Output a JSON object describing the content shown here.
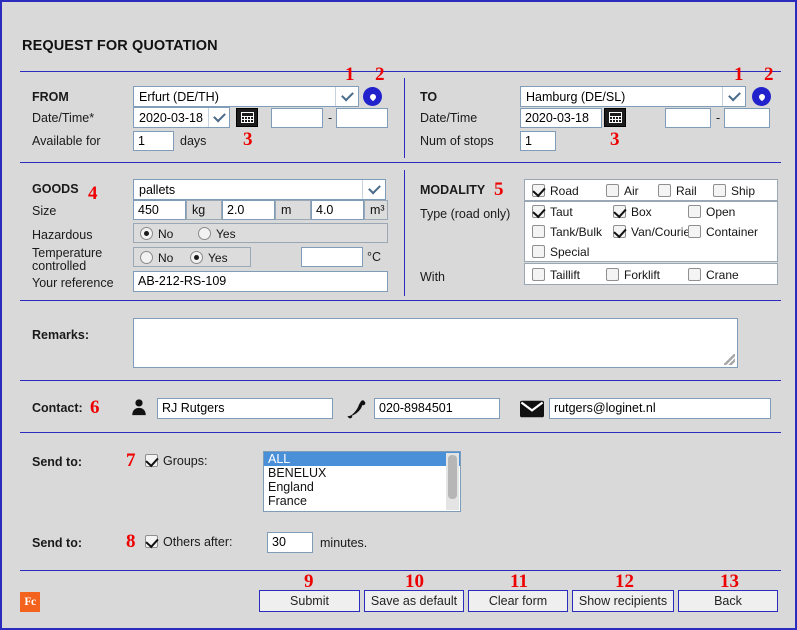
{
  "page": {
    "title": "REQUEST FOR QUOTATION",
    "logo_text": "Fc",
    "accent_color": "#2b2bbd",
    "marker_color": "#ee0000",
    "background": "#d9d9d9"
  },
  "from": {
    "label": "FROM",
    "location": "Erfurt (DE/TH)",
    "datetime_label": "Date/Time*",
    "date_value": "2020-03-18",
    "time_from": "",
    "time_sep": "-",
    "time_to": "",
    "available_label": "Available for",
    "available_value": "1",
    "available_unit": "days",
    "marker_dropdown": "1",
    "marker_pin": "2",
    "marker_calendar": "3"
  },
  "to": {
    "label": "TO",
    "location": "Hamburg (DE/SL)",
    "datetime_label": "Date/Time",
    "date_value": "2020-03-18",
    "time_from": "",
    "time_sep": "-",
    "time_to": "",
    "stops_label": "Num of stops",
    "stops_value": "1",
    "marker_dropdown": "1",
    "marker_pin": "2",
    "marker_calendar": "3"
  },
  "goods": {
    "label": "GOODS",
    "marker": "4",
    "type_value": "pallets",
    "size_label": "Size",
    "weight_value": "450",
    "weight_unit": "kg",
    "length_value": "2.0",
    "length_unit": "m",
    "volume_value": "4.0",
    "volume_unit": "m³",
    "hazardous_label": "Hazardous",
    "hazardous_no": "No",
    "hazardous_yes": "Yes",
    "hazardous_selected": "No",
    "temp_label_1": "Temperature",
    "temp_label_2": "controlled",
    "temp_no": "No",
    "temp_yes": "Yes",
    "temp_selected": "Yes",
    "temp_value": "",
    "temp_unit": "°C",
    "reference_label": "Your reference",
    "reference_value": "AB-212-RS-109"
  },
  "modality": {
    "label": "MODALITY",
    "marker": "5",
    "type_label": "Type (road only)",
    "with_label": "With",
    "transport": [
      {
        "label": "Road",
        "checked": true
      },
      {
        "label": "Air",
        "checked": false
      },
      {
        "label": "Rail",
        "checked": false
      },
      {
        "label": "Ship",
        "checked": false
      }
    ],
    "types": [
      {
        "label": "Taut",
        "checked": true
      },
      {
        "label": "Box",
        "checked": true
      },
      {
        "label": "Open",
        "checked": false
      },
      {
        "label": "Tank/Bulk",
        "checked": false
      },
      {
        "label": "Van/Courier",
        "checked": true
      },
      {
        "label": "Container",
        "checked": false
      },
      {
        "label": "Special",
        "checked": false
      }
    ],
    "equipment": [
      {
        "label": "Taillift",
        "checked": false
      },
      {
        "label": "Forklift",
        "checked": false
      },
      {
        "label": "Crane",
        "checked": false
      }
    ]
  },
  "remarks": {
    "label": "Remarks:",
    "value": ""
  },
  "contact": {
    "label": "Contact:",
    "marker": "6",
    "name_value": "RJ Rutgers",
    "phone_value": "020-8984501",
    "email_value": "rutgers@loginet.nl",
    "person_icon": "person-icon",
    "phone_icon": "phone-icon",
    "mail_icon": "mail-icon"
  },
  "send_to_groups": {
    "label": "Send to:",
    "marker": "7",
    "checkbox_label": "Groups:",
    "checked": true,
    "options": [
      "ALL",
      "BENELUX",
      "England",
      "France"
    ],
    "selected": "ALL"
  },
  "send_to_others": {
    "label": "Send to:",
    "marker": "8",
    "checkbox_label": "Others after:",
    "checked": true,
    "minutes_value": "30",
    "minutes_unit": "minutes."
  },
  "buttons": [
    {
      "label": "Submit",
      "marker": "9"
    },
    {
      "label": "Save as default",
      "marker": "10"
    },
    {
      "label": "Clear form",
      "marker": "11"
    },
    {
      "label": "Show recipients",
      "marker": "12"
    },
    {
      "label": "Back",
      "marker": "13"
    }
  ]
}
